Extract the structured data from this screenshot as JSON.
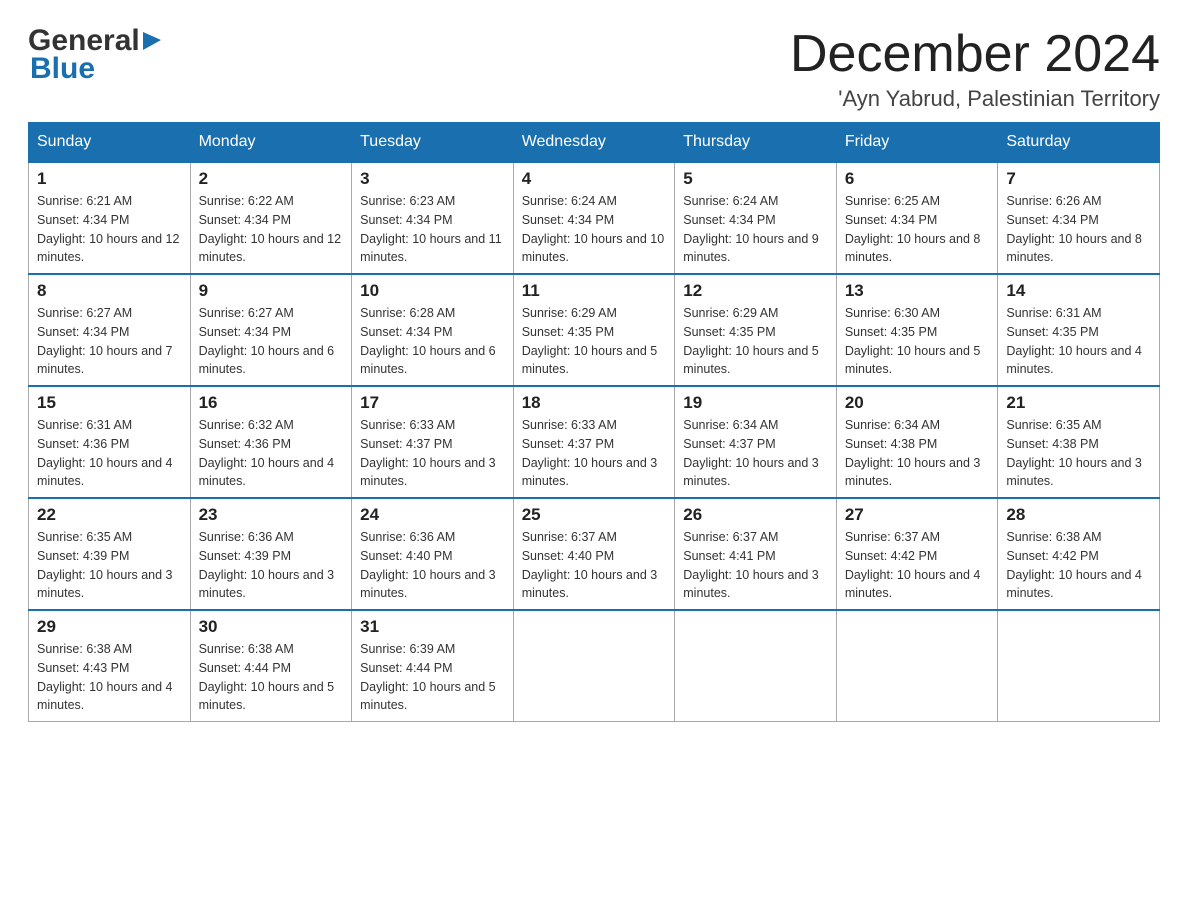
{
  "header": {
    "logo_general": "General",
    "logo_blue": "Blue",
    "month_title": "December 2024",
    "location": "'Ayn Yabrud, Palestinian Territory"
  },
  "calendar": {
    "days_of_week": [
      "Sunday",
      "Monday",
      "Tuesday",
      "Wednesday",
      "Thursday",
      "Friday",
      "Saturday"
    ],
    "weeks": [
      [
        {
          "day": "1",
          "sunrise": "6:21 AM",
          "sunset": "4:34 PM",
          "daylight": "10 hours and 12 minutes."
        },
        {
          "day": "2",
          "sunrise": "6:22 AM",
          "sunset": "4:34 PM",
          "daylight": "10 hours and 12 minutes."
        },
        {
          "day": "3",
          "sunrise": "6:23 AM",
          "sunset": "4:34 PM",
          "daylight": "10 hours and 11 minutes."
        },
        {
          "day": "4",
          "sunrise": "6:24 AM",
          "sunset": "4:34 PM",
          "daylight": "10 hours and 10 minutes."
        },
        {
          "day": "5",
          "sunrise": "6:24 AM",
          "sunset": "4:34 PM",
          "daylight": "10 hours and 9 minutes."
        },
        {
          "day": "6",
          "sunrise": "6:25 AM",
          "sunset": "4:34 PM",
          "daylight": "10 hours and 8 minutes."
        },
        {
          "day": "7",
          "sunrise": "6:26 AM",
          "sunset": "4:34 PM",
          "daylight": "10 hours and 8 minutes."
        }
      ],
      [
        {
          "day": "8",
          "sunrise": "6:27 AM",
          "sunset": "4:34 PM",
          "daylight": "10 hours and 7 minutes."
        },
        {
          "day": "9",
          "sunrise": "6:27 AM",
          "sunset": "4:34 PM",
          "daylight": "10 hours and 6 minutes."
        },
        {
          "day": "10",
          "sunrise": "6:28 AM",
          "sunset": "4:34 PM",
          "daylight": "10 hours and 6 minutes."
        },
        {
          "day": "11",
          "sunrise": "6:29 AM",
          "sunset": "4:35 PM",
          "daylight": "10 hours and 5 minutes."
        },
        {
          "day": "12",
          "sunrise": "6:29 AM",
          "sunset": "4:35 PM",
          "daylight": "10 hours and 5 minutes."
        },
        {
          "day": "13",
          "sunrise": "6:30 AM",
          "sunset": "4:35 PM",
          "daylight": "10 hours and 5 minutes."
        },
        {
          "day": "14",
          "sunrise": "6:31 AM",
          "sunset": "4:35 PM",
          "daylight": "10 hours and 4 minutes."
        }
      ],
      [
        {
          "day": "15",
          "sunrise": "6:31 AM",
          "sunset": "4:36 PM",
          "daylight": "10 hours and 4 minutes."
        },
        {
          "day": "16",
          "sunrise": "6:32 AM",
          "sunset": "4:36 PM",
          "daylight": "10 hours and 4 minutes."
        },
        {
          "day": "17",
          "sunrise": "6:33 AM",
          "sunset": "4:37 PM",
          "daylight": "10 hours and 3 minutes."
        },
        {
          "day": "18",
          "sunrise": "6:33 AM",
          "sunset": "4:37 PM",
          "daylight": "10 hours and 3 minutes."
        },
        {
          "day": "19",
          "sunrise": "6:34 AM",
          "sunset": "4:37 PM",
          "daylight": "10 hours and 3 minutes."
        },
        {
          "day": "20",
          "sunrise": "6:34 AM",
          "sunset": "4:38 PM",
          "daylight": "10 hours and 3 minutes."
        },
        {
          "day": "21",
          "sunrise": "6:35 AM",
          "sunset": "4:38 PM",
          "daylight": "10 hours and 3 minutes."
        }
      ],
      [
        {
          "day": "22",
          "sunrise": "6:35 AM",
          "sunset": "4:39 PM",
          "daylight": "10 hours and 3 minutes."
        },
        {
          "day": "23",
          "sunrise": "6:36 AM",
          "sunset": "4:39 PM",
          "daylight": "10 hours and 3 minutes."
        },
        {
          "day": "24",
          "sunrise": "6:36 AM",
          "sunset": "4:40 PM",
          "daylight": "10 hours and 3 minutes."
        },
        {
          "day": "25",
          "sunrise": "6:37 AM",
          "sunset": "4:40 PM",
          "daylight": "10 hours and 3 minutes."
        },
        {
          "day": "26",
          "sunrise": "6:37 AM",
          "sunset": "4:41 PM",
          "daylight": "10 hours and 3 minutes."
        },
        {
          "day": "27",
          "sunrise": "6:37 AM",
          "sunset": "4:42 PM",
          "daylight": "10 hours and 4 minutes."
        },
        {
          "day": "28",
          "sunrise": "6:38 AM",
          "sunset": "4:42 PM",
          "daylight": "10 hours and 4 minutes."
        }
      ],
      [
        {
          "day": "29",
          "sunrise": "6:38 AM",
          "sunset": "4:43 PM",
          "daylight": "10 hours and 4 minutes."
        },
        {
          "day": "30",
          "sunrise": "6:38 AM",
          "sunset": "4:44 PM",
          "daylight": "10 hours and 5 minutes."
        },
        {
          "day": "31",
          "sunrise": "6:39 AM",
          "sunset": "4:44 PM",
          "daylight": "10 hours and 5 minutes."
        },
        null,
        null,
        null,
        null
      ]
    ]
  }
}
